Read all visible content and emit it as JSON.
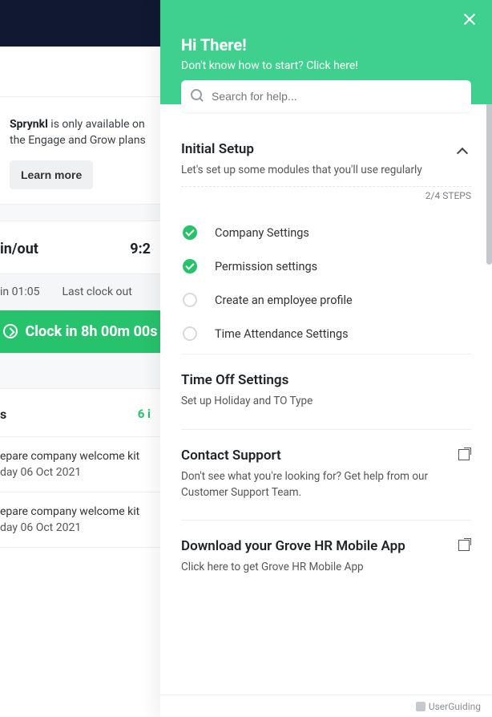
{
  "background": {
    "sprynkl_bold": "Sprynkl",
    "sprynkl_text": " is only available on the Engage and Grow plans",
    "learn_more": "Learn more",
    "clock_title": "in/out",
    "clock_time": "9:2",
    "last_in": "in 01:05",
    "last_out_label": "Last clock out",
    "clockin_btn": "Clock in 8h 00m 00s",
    "tasks_suffix": "s",
    "tasks_count": "6 i",
    "task1_title": "epare company welcome kit",
    "task1_sub": "day 06 Oct 2021",
    "task2_title": "epare company welcome kit",
    "task2_sub": "day 06 Oct 2021"
  },
  "help": {
    "greeting": "Hi There!",
    "subtitle": "Don't know how to start? Click here!",
    "search_placeholder": "Search for help...",
    "setup": {
      "title": "Initial Setup",
      "subtitle": "Let's set up some modules that you'll use regularly",
      "steps_label": "2/4 STEPS",
      "items": [
        {
          "label": "Company Settings",
          "done": true
        },
        {
          "label": "Permission settings",
          "done": true
        },
        {
          "label": "Create an employee profile",
          "done": false
        },
        {
          "label": "Time Attendance Settings",
          "done": false
        }
      ]
    },
    "timeoff": {
      "title": "Time Off Settings",
      "subtitle": "Set up Holiday and TO Type"
    },
    "support": {
      "title": "Contact Support",
      "subtitle": "Don't see what you're looking for? Get help from our Customer Support Team."
    },
    "mobile": {
      "title": "Download your Grove HR Mobile App",
      "subtitle": "Click here to get Grove HR Mobile App"
    },
    "footer": "UserGuiding"
  }
}
